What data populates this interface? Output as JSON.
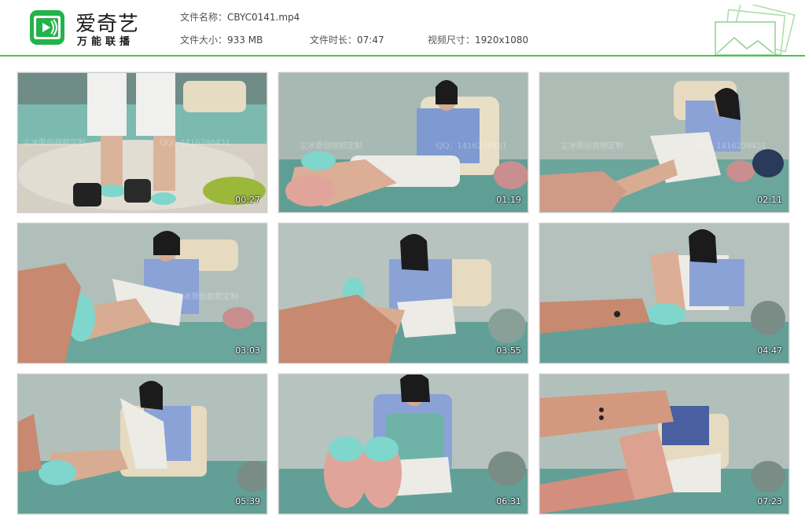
{
  "brand": {
    "title": "爱奇艺",
    "subtitle": "万能联播"
  },
  "file_info": {
    "name_label": "文件名称：",
    "name_value": "CBYC0141.mp4",
    "size_label": "文件大小：",
    "size_value": "933 MB",
    "duration_label": "文件时长：",
    "duration_value": "07:47",
    "dimensions_label": "视频尺寸：",
    "dimensions_value": "1920x1080"
  },
  "colors": {
    "accent": "#4fbf4f",
    "logo_green": "#22b34a"
  },
  "watermark": {
    "left": "尘冰原创视频定制",
    "right": "QQ：1416298431"
  },
  "thumbnails": [
    {
      "timestamp": "00:27",
      "icon": "video-frame"
    },
    {
      "timestamp": "01:19",
      "icon": "video-frame"
    },
    {
      "timestamp": "02:11",
      "icon": "video-frame"
    },
    {
      "timestamp": "03:03",
      "icon": "video-frame"
    },
    {
      "timestamp": "03:55",
      "icon": "video-frame"
    },
    {
      "timestamp": "04:47",
      "icon": "video-frame"
    },
    {
      "timestamp": "05:39",
      "icon": "video-frame"
    },
    {
      "timestamp": "06:31",
      "icon": "video-frame"
    },
    {
      "timestamp": "07:23",
      "icon": "video-frame"
    }
  ]
}
